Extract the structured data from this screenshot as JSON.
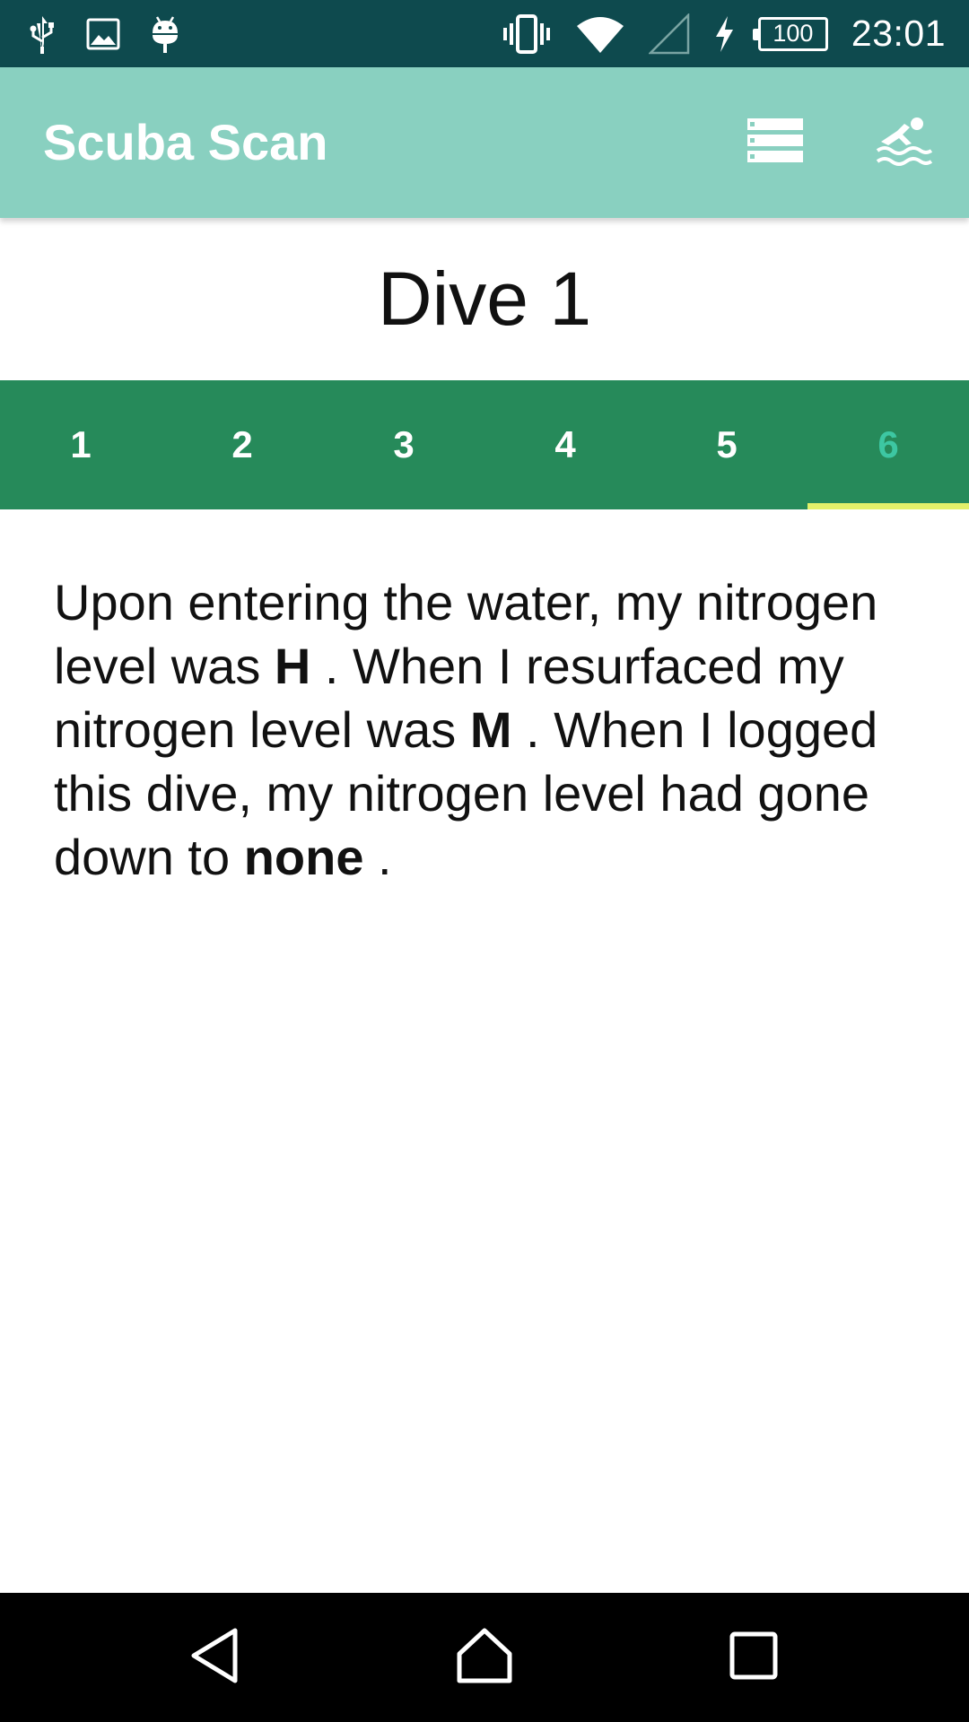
{
  "status_bar": {
    "battery_level": "100",
    "time": "23:01",
    "icons": [
      "usb-icon",
      "image-icon",
      "android-debug-icon",
      "vibrate-icon",
      "wifi-icon",
      "cell-signal-icon",
      "charging-icon",
      "battery-icon"
    ]
  },
  "app_bar": {
    "title": "Scuba Scan",
    "actions": [
      "list-icon",
      "swimmer-icon"
    ]
  },
  "dive": {
    "title": "Dive 1"
  },
  "tabs": [
    {
      "label": "1",
      "active": false
    },
    {
      "label": "2",
      "active": false
    },
    {
      "label": "3",
      "active": false
    },
    {
      "label": "4",
      "active": false
    },
    {
      "label": "5",
      "active": false
    },
    {
      "label": "6",
      "active": true
    }
  ],
  "content": {
    "part1": "Upon entering the water, my nitrogen level was ",
    "start_level": "H",
    "part2": " . When I resurfaced my nitrogen level was ",
    "end_level": "M",
    "part3": " . When I logged this dive, my nitrogen level had gone down to ",
    "logged_level": "none",
    "part4": " ."
  },
  "colors": {
    "status_bar": "#0e4a4e",
    "app_bar": "#89d0c0",
    "tab_bar": "#268a5a",
    "active_tab_text": "#3dc7a2",
    "tab_indicator": "#e3f06a",
    "nav_bar": "#000000"
  }
}
